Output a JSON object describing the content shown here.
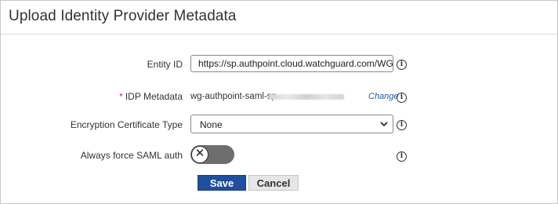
{
  "dialog": {
    "title": "Upload Identity Provider Metadata"
  },
  "form": {
    "entity_id": {
      "label": "Entity ID",
      "value": "https://sp.authpoint.cloud.watchguard.com/WG..."
    },
    "idp_metadata": {
      "required_marker": "*",
      "label": "IDP Metadata",
      "value": "wg-authpoint-saml-sp-",
      "change_link": "Change"
    },
    "encryption_certificate_type": {
      "label": "Encryption Certificate Type",
      "selected": "None"
    },
    "always_force_saml_auth": {
      "label": "Always force SAML auth",
      "enabled": false,
      "knob_glyph": "✕"
    }
  },
  "buttons": {
    "save": "Save",
    "cancel": "Cancel"
  },
  "icons": {
    "info": "i"
  },
  "colors": {
    "primary": "#1f4f9e",
    "link": "#1c5aa8",
    "required": "#c0392b",
    "toggle_off": "#6e6e6e"
  }
}
